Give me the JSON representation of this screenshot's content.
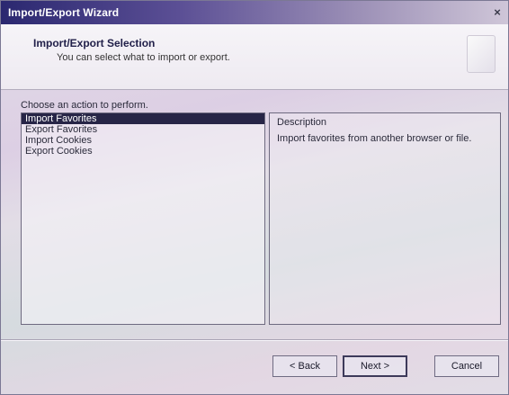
{
  "window": {
    "title": "Import/Export Wizard",
    "close_glyph": "×"
  },
  "header": {
    "title": "Import/Export Selection",
    "subtitle": "You can select what to import or export."
  },
  "main": {
    "prompt": "Choose an action to perform.",
    "actions": [
      {
        "label": "Import Favorites",
        "selected": true
      },
      {
        "label": "Export Favorites",
        "selected": false
      },
      {
        "label": "Import Cookies",
        "selected": false
      },
      {
        "label": "Export Cookies",
        "selected": false
      }
    ],
    "description_label": "Description",
    "description_text": "Import favorites from another browser or file."
  },
  "buttons": {
    "back": "< Back",
    "next": "Next >",
    "cancel": "Cancel"
  },
  "colors": {
    "title_bar_start": "#2b2870",
    "selection": "#272547"
  }
}
